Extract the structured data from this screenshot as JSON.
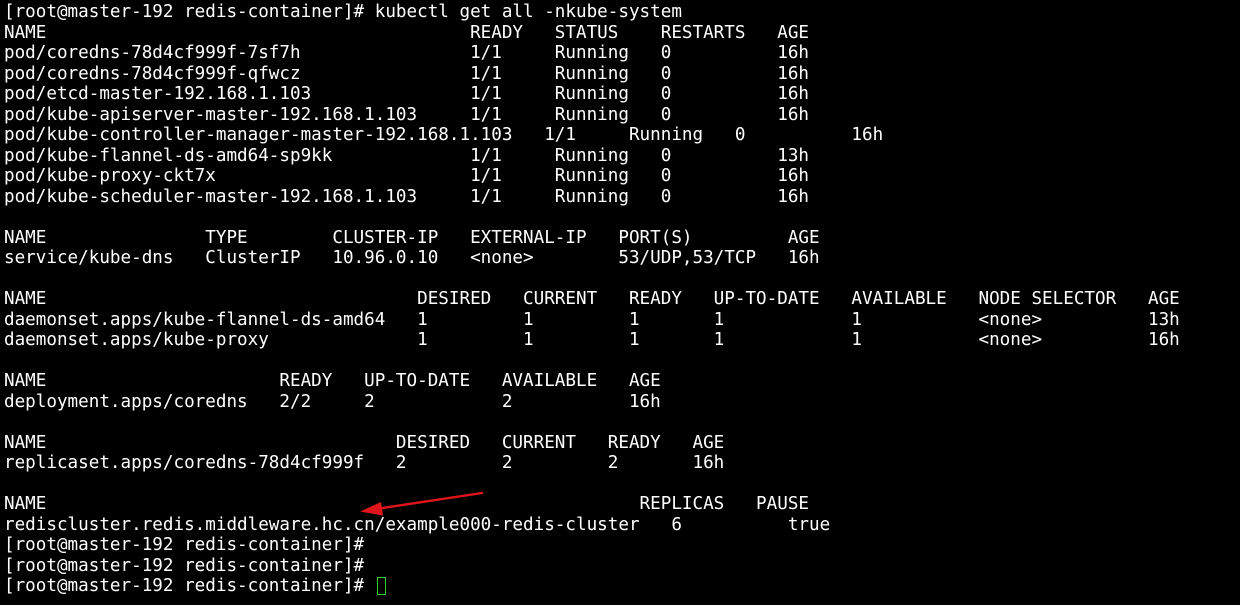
{
  "terminal": {
    "lines": [
      "[root@master-192 redis-container]# kubectl get all -nkube-system",
      "NAME                                        READY   STATUS    RESTARTS   AGE",
      "pod/coredns-78d4cf999f-7sf7h                1/1     Running   0          16h",
      "pod/coredns-78d4cf999f-qfwcz                1/1     Running   0          16h",
      "pod/etcd-master-192.168.1.103               1/1     Running   0          16h",
      "pod/kube-apiserver-master-192.168.1.103     1/1     Running   0          16h",
      "pod/kube-controller-manager-master-192.168.1.103   1/1     Running   0          16h",
      "pod/kube-flannel-ds-amd64-sp9kk             1/1     Running   0          13h",
      "pod/kube-proxy-ckt7x                        1/1     Running   0          16h",
      "pod/kube-scheduler-master-192.168.1.103     1/1     Running   0          16h",
      "",
      "NAME               TYPE        CLUSTER-IP   EXTERNAL-IP   PORT(S)         AGE",
      "service/kube-dns   ClusterIP   10.96.0.10   <none>        53/UDP,53/TCP   16h",
      "",
      "NAME                                   DESIRED   CURRENT   READY   UP-TO-DATE   AVAILABLE   NODE SELECTOR   AGE",
      "daemonset.apps/kube-flannel-ds-amd64   1         1         1       1            1           <none>          13h",
      "daemonset.apps/kube-proxy              1         1         1       1            1           <none>          16h",
      "",
      "NAME                      READY   UP-TO-DATE   AVAILABLE   AGE",
      "deployment.apps/coredns   2/2     2            2           16h",
      "",
      "NAME                                 DESIRED   CURRENT   READY   AGE",
      "replicaset.apps/coredns-78d4cf999f   2         2         2       16h",
      "",
      "NAME                                                        REPLICAS   PAUSE",
      "rediscluster.redis.middleware.hc.cn/example000-redis-cluster   6          true",
      "[root@master-192 redis-container]#",
      "[root@master-192 redis-container]#",
      "[root@master-192 redis-container]# "
    ]
  },
  "colors": {
    "background": "#000000",
    "text": "#ffffff",
    "cursor": "#2ad32a",
    "arrow": "#e0151b"
  }
}
